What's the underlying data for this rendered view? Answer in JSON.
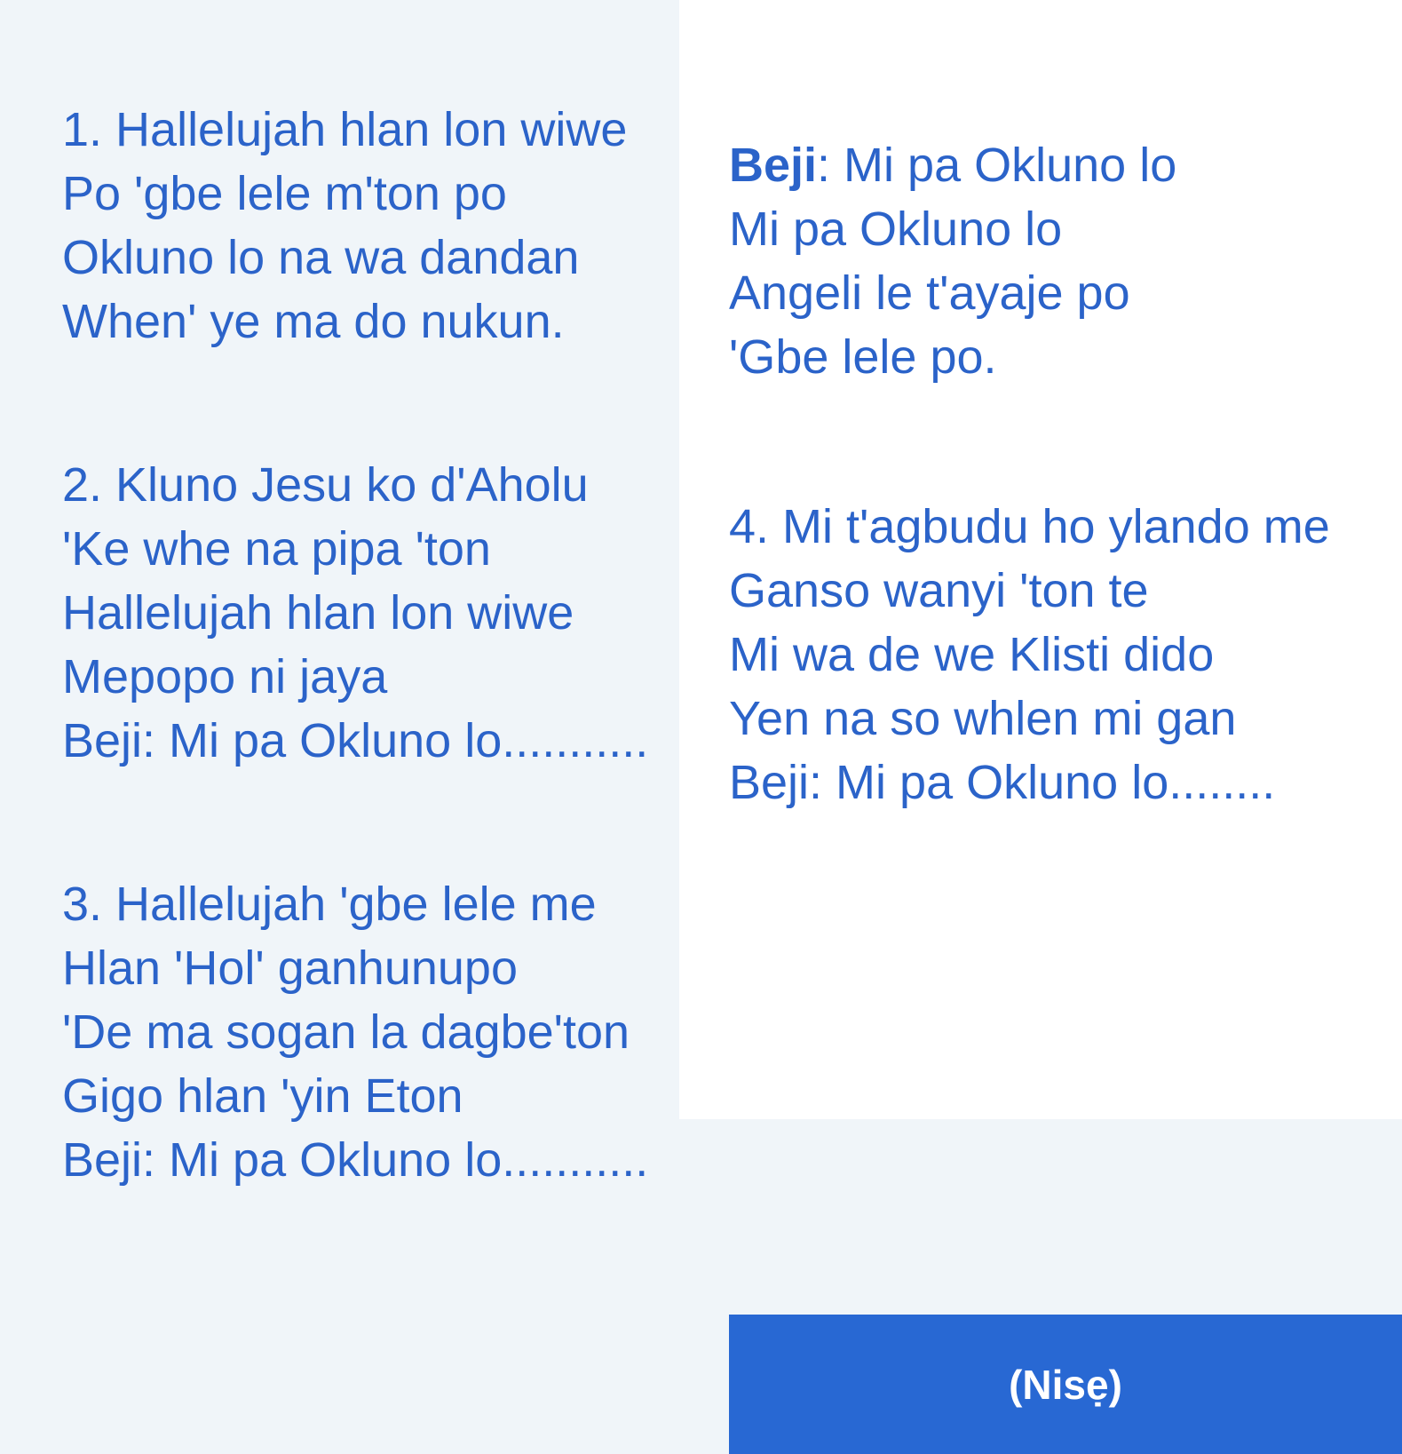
{
  "stanza1": {
    "lines": [
      "1. Hallelujah hlan lon wiwe",
      "Po 'gbe lele m'ton po",
      "Okluno lo na wa dandan",
      "When' ye ma do nukun."
    ]
  },
  "stanza2": {
    "lines": [
      "2. Kluno Jesu ko d'Aholu",
      "'Ke whe na pipa 'ton",
      "Hallelujah hlan lon wiwe",
      "Mepopo ni jaya",
      "Beji: Mi pa Okluno lo..........."
    ]
  },
  "stanza3": {
    "lines": [
      "3. Hallelujah 'gbe lele me",
      "Hlan 'Hol' ganhunupo",
      "'De ma sogan la dagbe'ton",
      "Gigo hlan 'yin Eton",
      "Beji: Mi pa Okluno lo..........."
    ]
  },
  "chorus": {
    "label": "Beji",
    "first_line_rest": ": Mi pa Okluno lo",
    "lines": [
      "Mi pa Okluno lo",
      "Angeli le t'ayaje po",
      "'Gbe lele po."
    ]
  },
  "stanza4": {
    "lines": [
      "4. Mi t'agbudu ho ylando me",
      "Ganso wanyi 'ton te",
      "Mi wa de we Klisti dido",
      "Yen na so whlen mi gan",
      "Beji: Mi pa Okluno lo........"
    ]
  },
  "footer": {
    "label": "(Nisẹ)"
  },
  "colors": {
    "text": "#2b63c9",
    "left_background": "#f0f5f9",
    "right_background": "#ffffff",
    "button_background": "#2868d3",
    "button_text": "#ffffff"
  }
}
